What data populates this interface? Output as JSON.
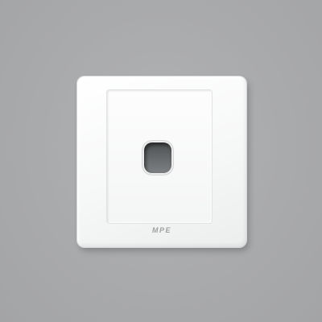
{
  "product": {
    "brand_text": "MPE"
  },
  "colors": {
    "background": "#a8a9ab",
    "plate": "#ffffff",
    "opening": "#55585a",
    "brand_text": "#9fa1a3"
  }
}
